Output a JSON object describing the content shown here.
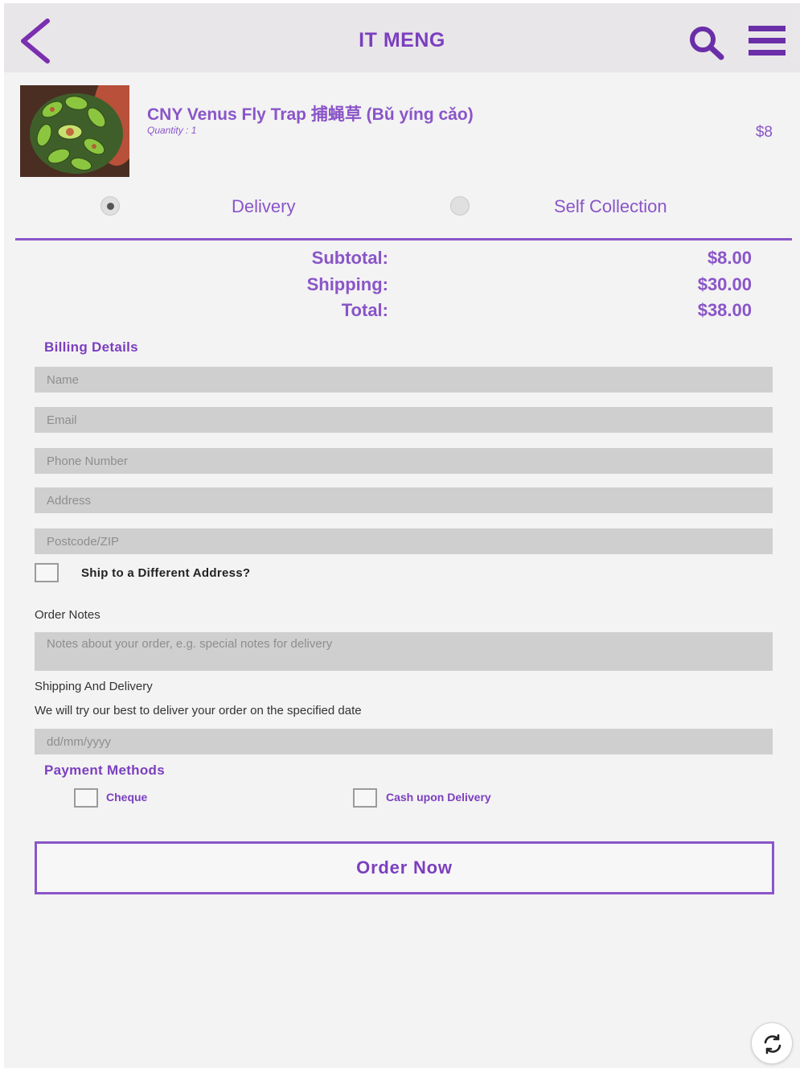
{
  "header": {
    "title": "IT MENG",
    "back_icon": "chevron-left-icon",
    "search_icon": "search-icon",
    "menu_icon": "hamburger-menu-icon"
  },
  "product": {
    "name": "CNY Venus Fly Trap 捕蝇草 (Bǔ yíng cǎo)",
    "quantity": "Quantity : 1",
    "price": "$8"
  },
  "delivery_options": [
    {
      "label": "Delivery",
      "selected": true
    },
    {
      "label": "Self Collection",
      "selected": false
    }
  ],
  "totals": {
    "subtotal_label": "Subtotal:",
    "subtotal_value": "$8.00",
    "shipping_label": "Shipping:",
    "shipping_value": "$30.00",
    "total_label": "Total:",
    "total_value": "$38.00"
  },
  "billing": {
    "title": "Billing Details",
    "name_placeholder": "Name",
    "email_placeholder": "Email",
    "phone_placeholder": "Phone Number",
    "address_placeholder": "Address",
    "postcode_placeholder": "Postcode/ZIP",
    "ship_different_label": "Ship to a Different Address?"
  },
  "order_notes": {
    "label": "Order Notes",
    "placeholder": "Notes about your order, e.g. special notes for delivery"
  },
  "shipping_delivery": {
    "label": "Shipping And Delivery",
    "description": "We will try our best to deliver your order on the specified date",
    "date_placeholder": "dd/mm/yyyy"
  },
  "payment": {
    "title": "Payment Methods",
    "options": [
      "Cheque",
      "Cash upon Delivery"
    ]
  },
  "order_button": "Order Now",
  "colors": {
    "accent": "#8a55c8",
    "accent_dark": "#6a2fa8",
    "header_bg": "#e9e6e9",
    "field_bg": "#cfcfcf",
    "page_bg": "#f3f3f3"
  }
}
